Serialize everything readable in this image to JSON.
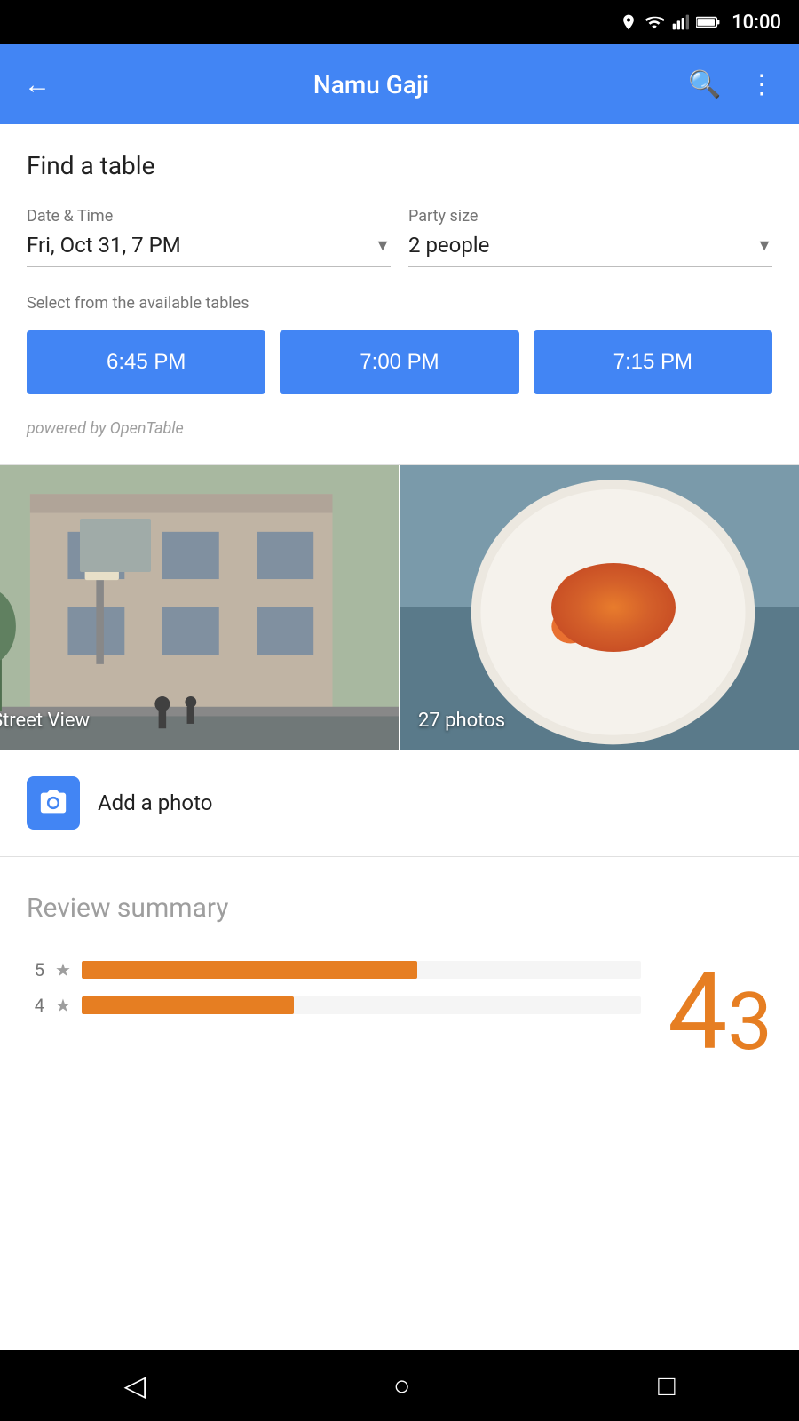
{
  "statusBar": {
    "time": "10:00",
    "icons": [
      "location",
      "wifi",
      "signal",
      "battery"
    ]
  },
  "appBar": {
    "backLabel": "←",
    "title": "Namu Gaji",
    "searchLabel": "🔍",
    "moreLabel": "⋮"
  },
  "findTable": {
    "heading": "Find a table",
    "dateLabel": "Date & Time",
    "dateValue": "Fri, Oct 31, 7 PM",
    "partySizeLabel": "Party size",
    "partySizeValue": "2 people",
    "availableLabel": "Select from the available tables",
    "timeSlots": [
      "6:45 PM",
      "7:00 PM",
      "7:15 PM"
    ],
    "poweredBy": "powered by OpenTable"
  },
  "photos": {
    "streetViewLabel": "Street View",
    "photosLabel": "27 photos",
    "addPhotoLabel": "Add a photo"
  },
  "reviewSummary": {
    "heading": "Review summary",
    "bars": [
      {
        "stars": 5,
        "width": 60
      },
      {
        "stars": 4,
        "width": 38
      }
    ],
    "bigRating": "4",
    "bigDecimal": "3"
  },
  "navBar": {
    "backIcon": "◁",
    "homeIcon": "○",
    "recentIcon": "□"
  }
}
